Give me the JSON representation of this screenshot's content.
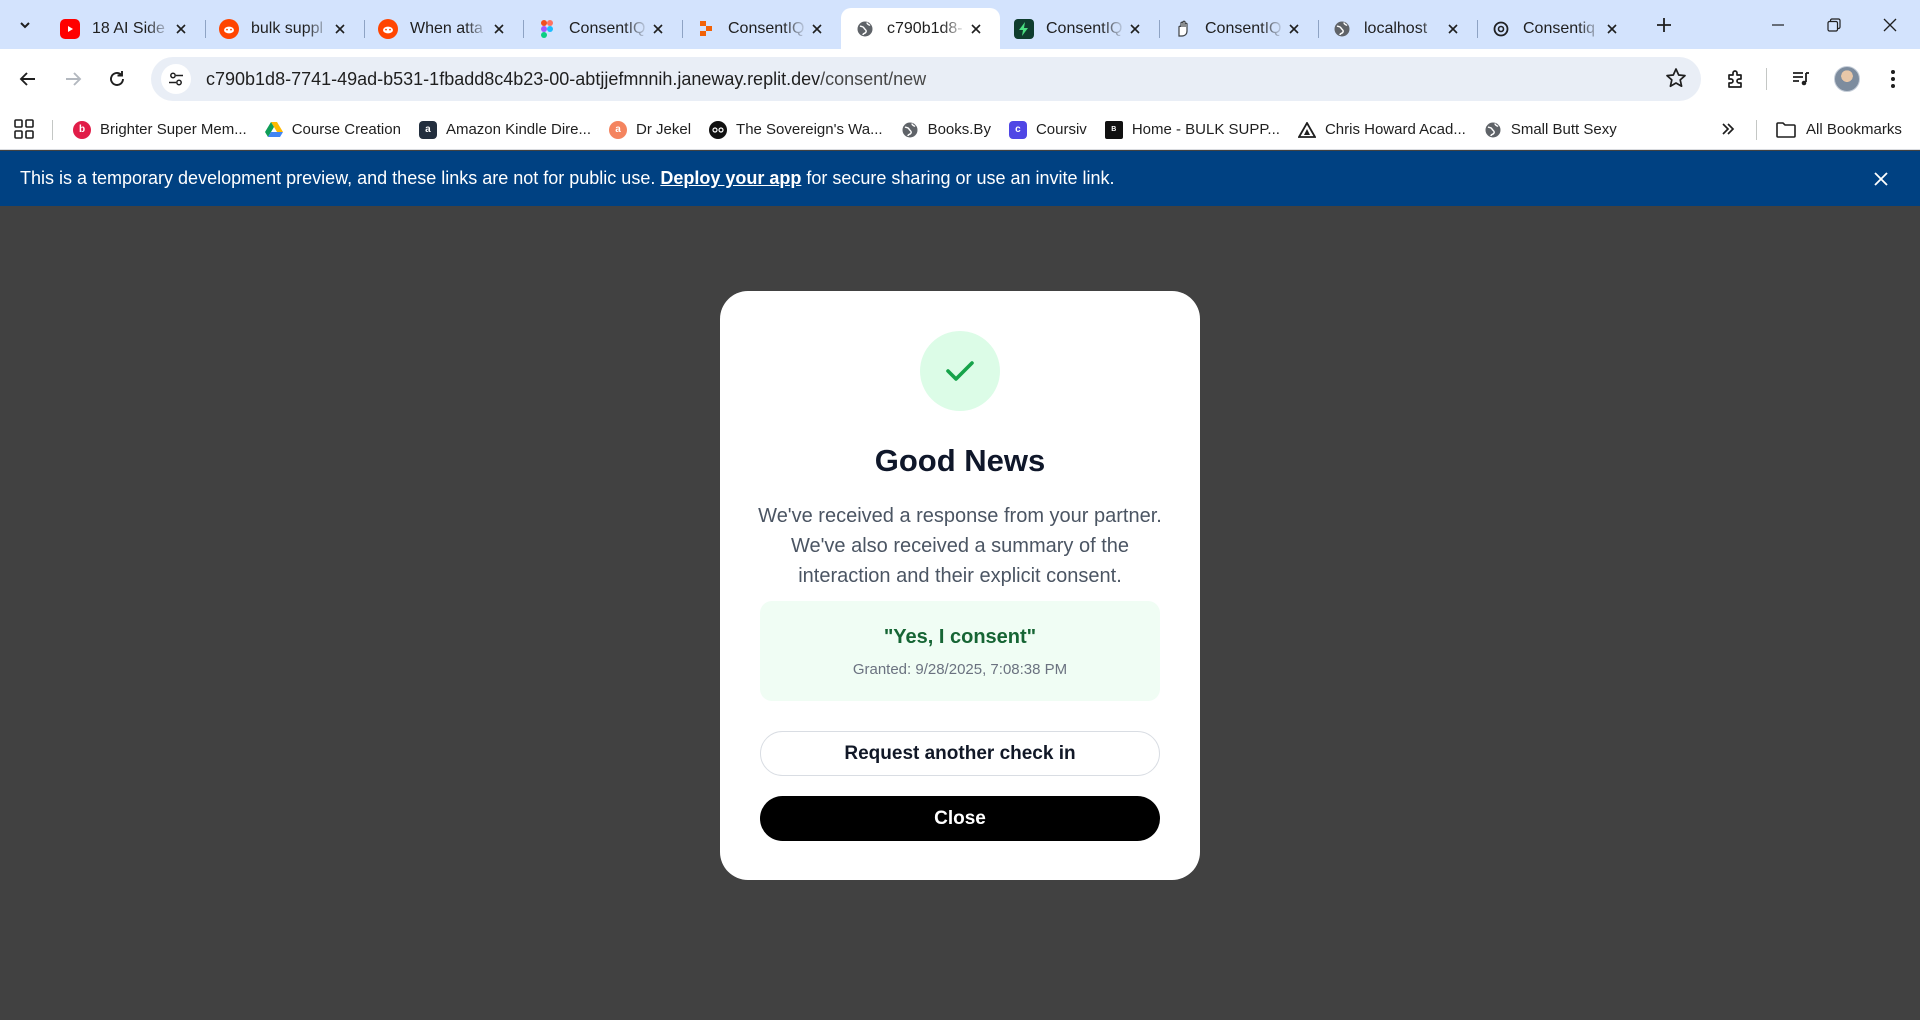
{
  "browser": {
    "tabs": [
      {
        "title": "18 AI Side",
        "favicon": "youtube-icon",
        "color": "#ff0000",
        "active": false
      },
      {
        "title": "bulk suppl",
        "favicon": "reddit-icon",
        "color": "#ff4500",
        "active": false
      },
      {
        "title": "When atta",
        "favicon": "reddit-icon",
        "color": "#ff4500",
        "active": false
      },
      {
        "title": "ConsentIQ",
        "favicon": "figma-icon",
        "color": "#a259ff",
        "active": false
      },
      {
        "title": "ConsentIQ",
        "favicon": "replit-icon",
        "color": "#f26207",
        "active": false
      },
      {
        "title": "c790b1d8-",
        "favicon": "globe-icon",
        "color": "#5f6368",
        "active": true
      },
      {
        "title": "ConsentIQ",
        "favicon": "bolt-icon",
        "color": "#0f5132",
        "active": false
      },
      {
        "title": "ConsentIQ",
        "favicon": "hand-icon",
        "color": "#5f6368",
        "active": false
      },
      {
        "title": "localhost",
        "favicon": "globe-icon",
        "color": "#5f6368",
        "active": false
      },
      {
        "title": "Consentiq",
        "favicon": "openai-icon",
        "color": "#202123",
        "active": false
      }
    ],
    "url_host": "c790b1d8-7741-49ad-b531-1fbadd8c4b23-00-abtjjefmnnih.janeway.replit.dev",
    "url_path": "/consent/new",
    "bookmarks": [
      {
        "label": "Brighter Super Mem...",
        "favicon": "brighter-icon",
        "color": "#e11d48"
      },
      {
        "label": "Course Creation",
        "favicon": "google-drive-icon",
        "color": "#1fa463"
      },
      {
        "label": "Amazon Kindle Dire...",
        "favicon": "amazon-icon",
        "color": "#232f3e"
      },
      {
        "label": "Dr Jekel",
        "favicon": "jekel-icon",
        "color": "#f4845f"
      },
      {
        "label": "The Sovereign's Wa...",
        "favicon": "sovereign-icon",
        "color": "#111111"
      },
      {
        "label": "Books.By",
        "favicon": "globe-icon",
        "color": "#5f6368"
      },
      {
        "label": "Coursiv",
        "favicon": "coursiv-icon",
        "color": "#4f46e5"
      },
      {
        "label": "Home - BULK SUPP...",
        "favicon": "bulk-icon",
        "color": "#111111"
      },
      {
        "label": "Chris Howard Acad...",
        "favicon": "triangle-icon",
        "color": "#1f1f1f"
      },
      {
        "label": "Small Butt Sexy",
        "favicon": "globe-icon",
        "color": "#5f6368"
      }
    ],
    "all_bookmarks_label": "All Bookmarks"
  },
  "banner": {
    "text_before": "This is a temporary development preview, and these links are not for public use.",
    "link_text": "Deploy your app",
    "text_after": "for secure sharing or use an invite link."
  },
  "modal": {
    "icon": "checkmark-icon",
    "title": "Good News",
    "body": "We've received a response from your partner. We've also received a summary of the interaction and their explicit consent.",
    "consent_quote": "\"Yes, I consent\"",
    "granted_text": "Granted: 9/28/2025, 7:08:38 PM",
    "secondary_button": "Request another check in",
    "primary_button": "Close"
  },
  "colors": {
    "banner_bg": "#004182",
    "overlay_bg": "#414141",
    "success_green": "#16a34a",
    "consent_bg": "#f0fdf4"
  }
}
